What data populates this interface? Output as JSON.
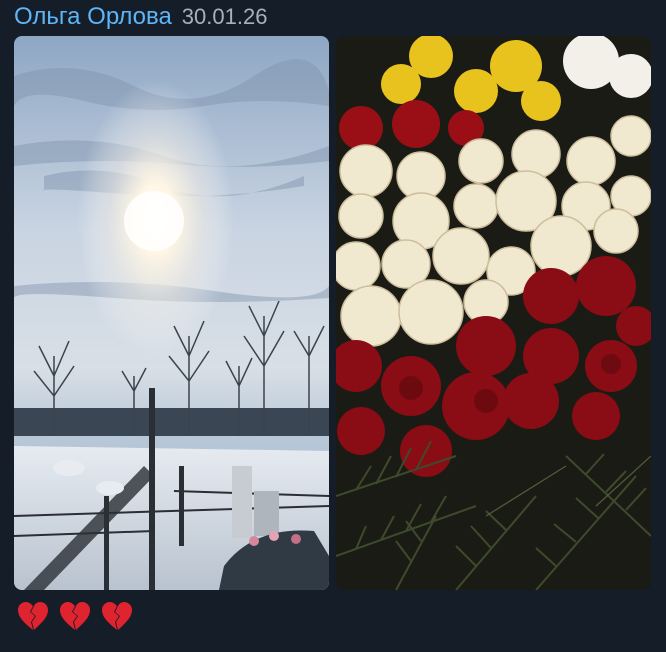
{
  "message": {
    "author": "Ольга Орлова",
    "date": "30.01.26",
    "photos": [
      {
        "name": "cemetery-winter-sky-photo"
      },
      {
        "name": "flowers-roses-photo"
      }
    ],
    "emoji": [
      "broken-heart-icon",
      "broken-heart-icon",
      "broken-heart-icon"
    ]
  }
}
